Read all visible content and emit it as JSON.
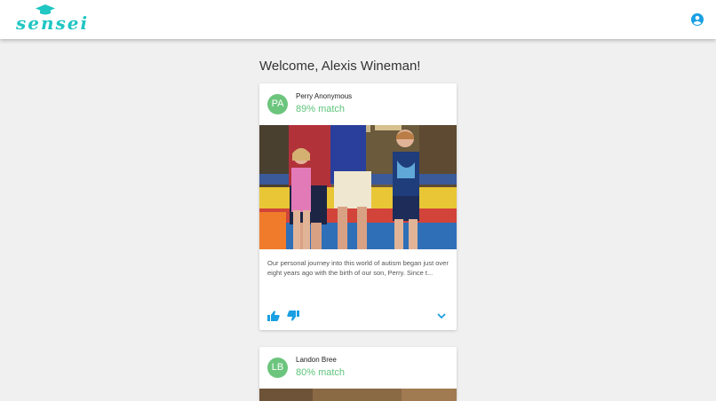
{
  "app": {
    "logo_text": "sensei",
    "brand_color": "#1fc6c3",
    "accent_color": "#1a9fe3",
    "match_color": "#5fc47a",
    "account_icon": "account-circle-icon"
  },
  "welcome": "Welcome, Alexis Wineman!",
  "feed": [
    {
      "initials": "PA",
      "author": "Perry Anonymous",
      "match": "89% match",
      "image": "photo of an adult standing with two children in a play area",
      "excerpt": "Our personal journey into this world of autism began just over eight years ago with the birth of our son, Perry. Since t...",
      "actions": {
        "like_icon": "thumb-up-icon",
        "dislike_icon": "thumb-down-icon",
        "expand_icon": "chevron-down-icon"
      }
    },
    {
      "initials": "LB",
      "author": "Landon Bree",
      "match": "80% match"
    }
  ]
}
